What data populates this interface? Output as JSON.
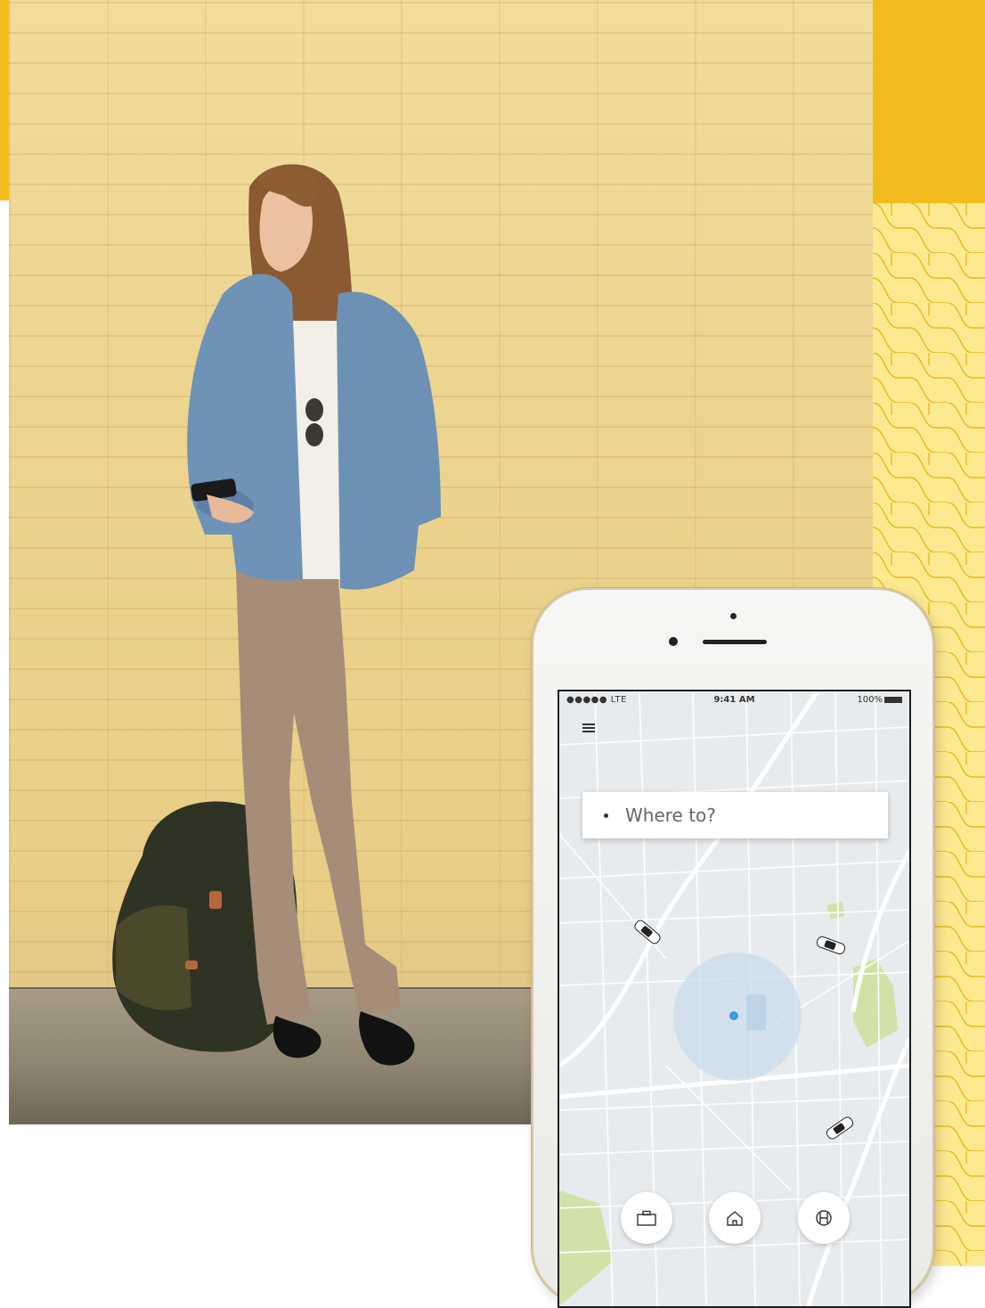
{
  "status_bar": {
    "carrier": "●●●●● LTE",
    "time": "9:41 AM",
    "battery": "100%"
  },
  "search": {
    "placeholder": "Where to?"
  },
  "shortcuts": [
    {
      "icon": "briefcase-icon"
    },
    {
      "icon": "home-icon"
    },
    {
      "icon": "globe-icon"
    }
  ],
  "colors": {
    "accent": "#f2bc1e",
    "pattern_bg": "#fde98f",
    "map_bg": "#e8ebee",
    "map_park": "#cfe3a8",
    "location_dot": "#3d9be0"
  }
}
